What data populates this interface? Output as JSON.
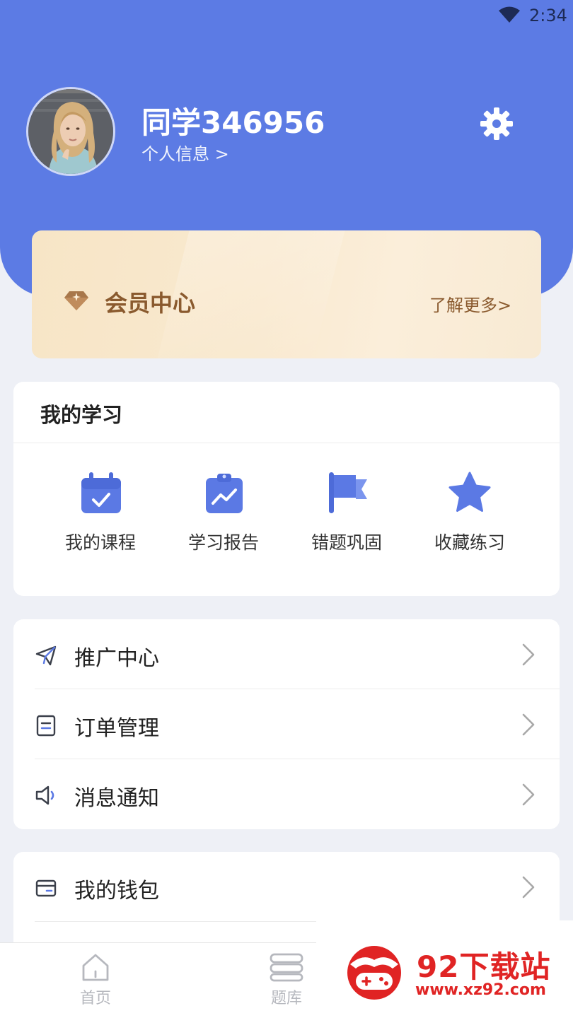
{
  "status_bar": {
    "time": "2:34"
  },
  "profile": {
    "username": "同学346956",
    "info_link": "个人信息 >"
  },
  "vip": {
    "title": "会员中心",
    "more": "了解更多>"
  },
  "study": {
    "title": "我的学习",
    "items": [
      {
        "label": "我的课程",
        "icon": "calendar-check-icon"
      },
      {
        "label": "学习报告",
        "icon": "clipboard-chart-icon"
      },
      {
        "label": "错题巩固",
        "icon": "flag-icon"
      },
      {
        "label": "收藏练习",
        "icon": "star-icon"
      }
    ]
  },
  "menu_group_1": [
    {
      "label": "推广中心",
      "icon": "paper-plane-icon"
    },
    {
      "label": "订单管理",
      "icon": "document-icon"
    },
    {
      "label": "消息通知",
      "icon": "speaker-icon"
    }
  ],
  "menu_group_2": [
    {
      "label": "我的钱包",
      "icon": "wallet-icon"
    }
  ],
  "bottom_nav": [
    {
      "label": "首页",
      "icon": "home-icon"
    },
    {
      "label": "题库",
      "icon": "question-bank-icon"
    }
  ],
  "watermark": {
    "title": "92下载站",
    "url": "www.xz92.com"
  },
  "colors": {
    "header": "#5c7be4",
    "accent_icon": "#5b79e4",
    "vip_text": "#8a5a2e",
    "watermark_red": "#e02424"
  }
}
